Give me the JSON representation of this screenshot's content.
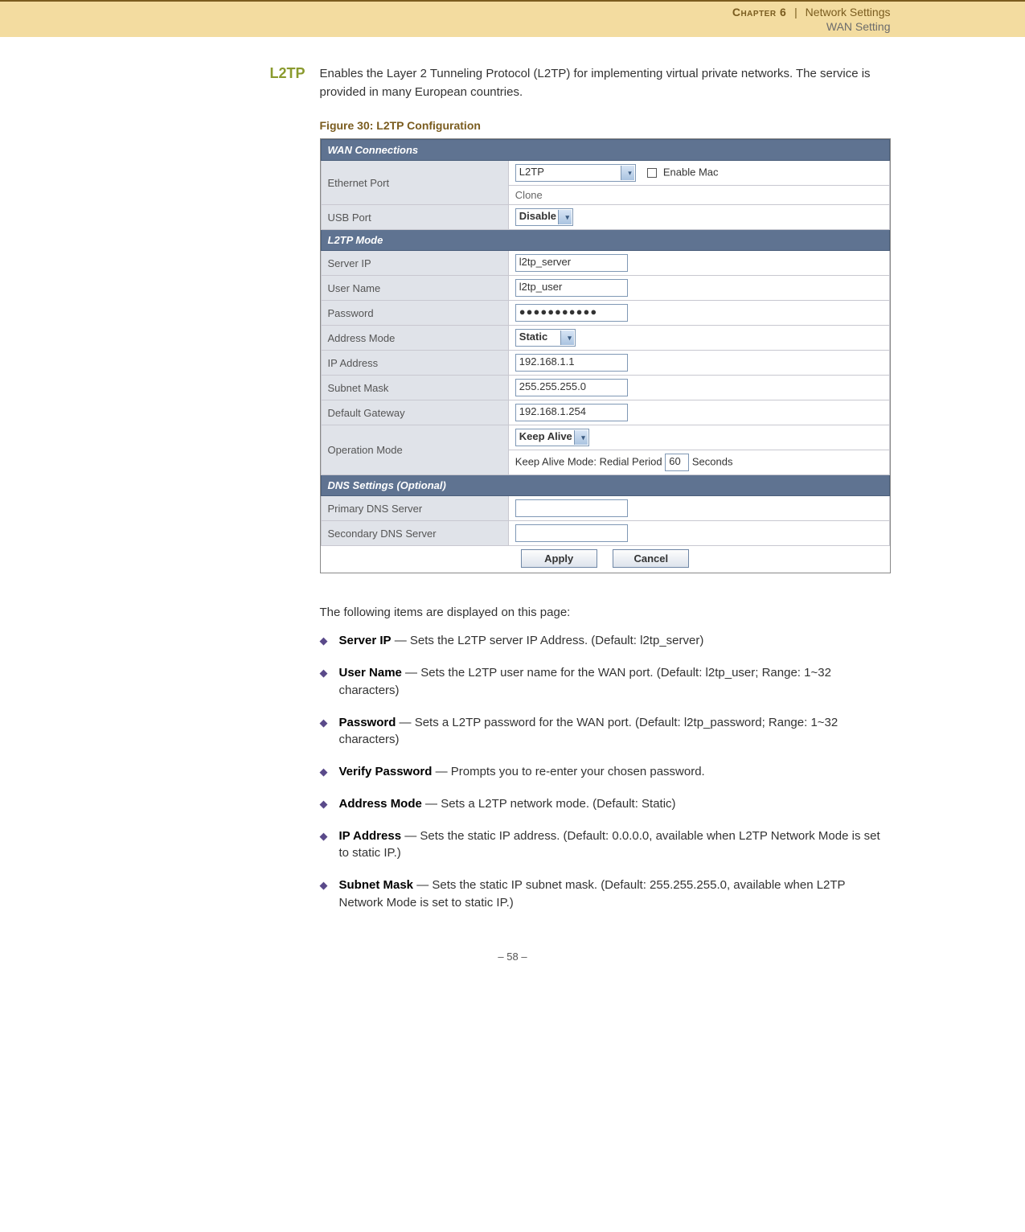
{
  "header": {
    "chapter": "Chapter 6",
    "separator": "|",
    "section": "Network Settings",
    "subsection": "WAN Setting"
  },
  "side_heading": "L2TP",
  "intro": "Enables the Layer 2 Tunneling Protocol (L2TP) for implementing virtual private networks. The service is provided in many European countries.",
  "figure_caption": "Figure 30:  L2TP Configuration",
  "screenshot": {
    "wan_header": "WAN Connections",
    "ethernet_port_label": "Ethernet Port",
    "ethernet_port_value": "L2TP",
    "enable_mac_label": "Enable Mac",
    "clone_label": "Clone",
    "usb_port_label": "USB Port",
    "usb_port_value": "Disable",
    "l2tp_header": "L2TP Mode",
    "server_ip_label": "Server IP",
    "server_ip_value": "l2tp_server",
    "user_name_label": "User Name",
    "user_name_value": "l2tp_user",
    "password_label": "Password",
    "password_value": "●●●●●●●●●●●",
    "address_mode_label": "Address Mode",
    "address_mode_value": "Static",
    "ip_address_label": "IP Address",
    "ip_address_value": "192.168.1.1",
    "subnet_mask_label": "Subnet Mask",
    "subnet_mask_value": "255.255.255.0",
    "default_gateway_label": "Default Gateway",
    "default_gateway_value": "192.168.1.254",
    "operation_mode_label": "Operation Mode",
    "operation_mode_value": "Keep Alive",
    "keep_alive_text": "Keep Alive Mode: Redial Period",
    "keep_alive_value": "60",
    "seconds_label": "Seconds",
    "dns_header": "DNS Settings (Optional)",
    "primary_dns_label": "Primary DNS Server",
    "secondary_dns_label": "Secondary DNS Server",
    "apply_button": "Apply",
    "cancel_button": "Cancel"
  },
  "following_text": "The following items are displayed on this page:",
  "items": [
    {
      "term": "Server IP",
      "desc": " — Sets the L2TP server IP Address. (Default: l2tp_server)"
    },
    {
      "term": "User Name",
      "desc": " — Sets the L2TP user name for the WAN port. (Default: l2tp_user; Range: 1~32 characters)"
    },
    {
      "term": "Password",
      "desc": " — Sets a L2TP password for the WAN port. (Default: l2tp_password; Range: 1~32 characters)"
    },
    {
      "term": "Verify Password",
      "desc": " — Prompts you to re-enter your chosen password."
    },
    {
      "term": "Address Mode",
      "desc": " — Sets a L2TP network mode. (Default: Static)"
    },
    {
      "term": "IP Address",
      "desc": " — Sets the static IP address. (Default: 0.0.0.0, available when L2TP Network Mode is set to static IP.)"
    },
    {
      "term": "Subnet Mask",
      "desc": " — Sets the static IP subnet mask. (Default: 255.255.255.0, available when L2TP Network Mode is set to static IP.)"
    }
  ],
  "page_number": "–  58  –"
}
